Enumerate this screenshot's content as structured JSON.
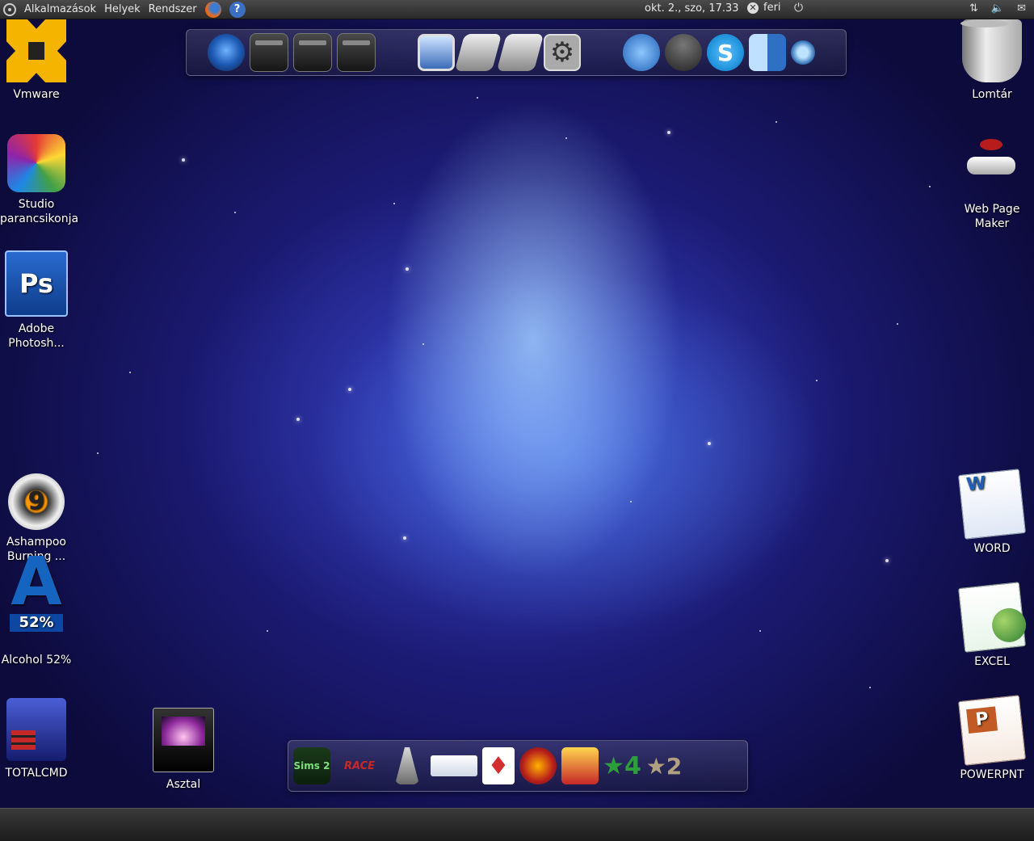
{
  "top_panel": {
    "menu": [
      "Alkalmazások",
      "Helyek",
      "Rendszer"
    ],
    "clock": "okt.  2., szo, 17.33",
    "user": "feri",
    "help_glyph": "?",
    "power_glyph": "⏻",
    "tray": [
      "⇅",
      "🔈",
      "✉"
    ]
  },
  "desktop_icons_left": [
    {
      "label": "Vmware",
      "icon": "vmware-icon"
    },
    {
      "label": "Studio parancsikonja",
      "icon": "studio-icon"
    },
    {
      "label": "Adobe Photosh...",
      "icon": "photoshop-icon"
    },
    {
      "label": "Ashampoo Burning ...",
      "icon": "ashampoo-icon"
    },
    {
      "label": "Alcohol 52%",
      "icon": "alcohol-icon"
    },
    {
      "label": "TOTALCMD",
      "icon": "totalcmd-icon"
    },
    {
      "label": "Asztal",
      "icon": "desktop-folder-icon"
    }
  ],
  "desktop_icons_right": [
    {
      "label": "Lomtár",
      "icon": "trash-icon"
    },
    {
      "label": "Web Page Maker",
      "icon": "web-page-maker-icon"
    },
    {
      "label": "WORD",
      "icon": "word-icon"
    },
    {
      "label": "EXCEL",
      "icon": "excel-icon"
    },
    {
      "label": "POWERPNT",
      "icon": "powerpoint-icon"
    }
  ],
  "top_dock_icons": [
    "globe-icon",
    "folder-icon",
    "pictures-folder-icon",
    "videos-folder-icon",
    "monitor-icon",
    "hard-disk-icon",
    "drive-icon",
    "settings-icon",
    "browser-icon",
    "messenger-icon",
    "skype-icon",
    "finder-icon",
    "saw-icon"
  ],
  "bottom_dock_icons": [
    "sims-2-icon",
    "race-icon",
    "tower-icon",
    "truck-icon",
    "cards-icon",
    "rollercoaster-icon",
    "rollercoaster-2-icon",
    "gta-4-icon",
    "star-2-icon"
  ]
}
